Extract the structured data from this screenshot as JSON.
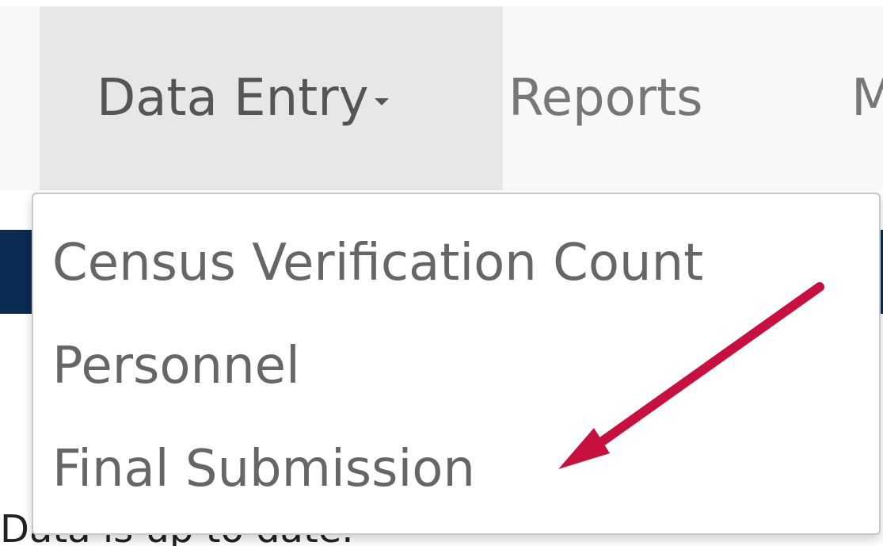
{
  "nav": {
    "items": [
      {
        "label": "Data Entry",
        "active": true,
        "has_dropdown": true
      },
      {
        "label": "Reports",
        "active": false
      },
      {
        "label": "M",
        "active": false
      }
    ]
  },
  "dropdown": {
    "items": [
      {
        "label": "Census Verification Count"
      },
      {
        "label": "Personnel"
      },
      {
        "label": "Final Submission"
      }
    ]
  },
  "behind": {
    "partial_text": "Data is up to date."
  },
  "annotation": {
    "arrow_color": "#c8103e"
  }
}
